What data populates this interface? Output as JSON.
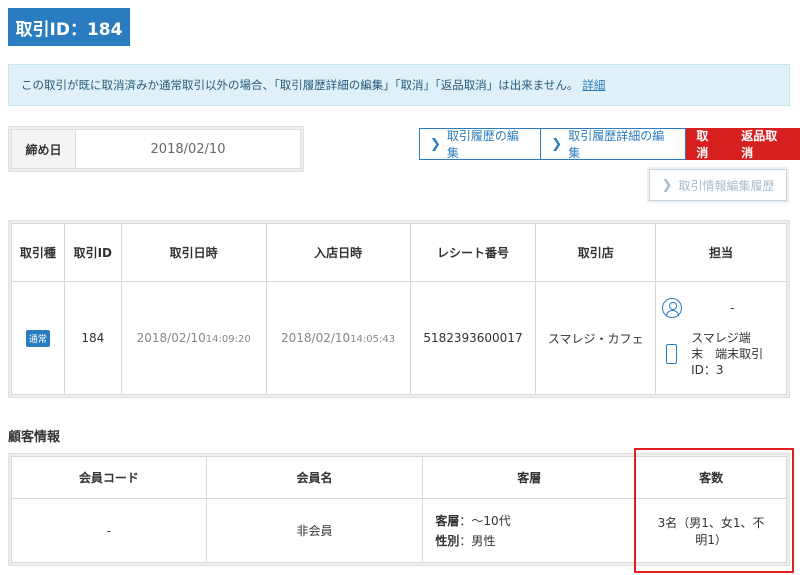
{
  "title": "取引ID：184",
  "notice": {
    "text": "この取引が既に取消済みか通常取引以外の場合、「取引履歴詳細の編集」「取消」「返品取消」は出来ません。",
    "link": "詳細"
  },
  "closing": {
    "label": "締め日",
    "value": "2018/02/10"
  },
  "actions": {
    "edit_history": "取引履歴の編集",
    "edit_detail": "取引履歴詳細の編集",
    "cancel": "取消",
    "return_cancel": "返品取消",
    "info_history": "取引情報編集履歴"
  },
  "transaction": {
    "headers": {
      "type": "取引種",
      "id": "取引ID",
      "datetime": "取引日時",
      "entry": "入店日時",
      "receipt": "レシート番号",
      "store": "取引店",
      "staff": "担当"
    },
    "row": {
      "type_badge": "通常",
      "id": "184",
      "datetime_date": "2018/02/10",
      "datetime_time": "14:09:20",
      "entry_date": "2018/02/10",
      "entry_time": "14:05:43",
      "receipt": "5182393600017",
      "store": "スマレジ・カフェ",
      "staff_name": "-",
      "terminal_line1": "スマレジ端",
      "terminal_line2": "末　端末取引",
      "terminal_line3": "ID：3"
    }
  },
  "customer_section": "顧客情報",
  "customer": {
    "headers": {
      "code": "会員コード",
      "name": "会員名",
      "tier": "客層",
      "count": "客数"
    },
    "row": {
      "code": "-",
      "name": "非会員",
      "tier_age_label": "客層",
      "tier_age_value": "：〜10代",
      "tier_gender_label": "性別",
      "tier_gender_value": "：男性",
      "count_line1": "3名（男1、女1、不",
      "count_line2": "明1）"
    }
  }
}
